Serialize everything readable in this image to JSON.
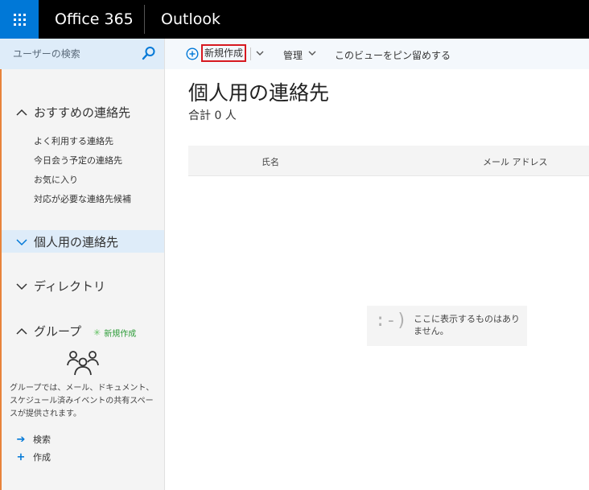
{
  "topbar": {
    "brand": "Office 365",
    "app": "Outlook"
  },
  "sidebar": {
    "search_placeholder": "ユーザーの検索",
    "sections": {
      "recommended": {
        "label": "おすすめの連絡先",
        "items": [
          "よく利用する連絡先",
          "今日会う予定の連絡先",
          "お気に入り",
          "対応が必要な連絡先候補"
        ]
      },
      "personal": {
        "label": "個人用の連絡先"
      },
      "directory": {
        "label": "ディレクトリ"
      },
      "groups": {
        "label": "グループ",
        "new_label": "新規作成",
        "description": "グループでは、メール、ドキュメント、スケジュール済みイベントの共有スペースが提供されます。",
        "links": [
          {
            "icon": "arrow-right-icon",
            "label": "検索"
          },
          {
            "icon": "plus-icon",
            "label": "作成"
          }
        ]
      }
    }
  },
  "commandbar": {
    "new_label": "新規作成",
    "manage_label": "管理",
    "pin_label": "このビューをピン留めする"
  },
  "main": {
    "title": "個人用の連絡先",
    "count": "合計 0 人",
    "columns": [
      "氏名",
      "メール アドレス"
    ],
    "empty_message": "ここに表示するものはありません。",
    "empty_face": ":-)"
  },
  "colors": {
    "topbar": "#000000",
    "waffle": "#0078d7",
    "accent": "#0078d7",
    "highlight": "#deecf9",
    "new_button_border": "#d71920",
    "group_new": "#2e9c39"
  }
}
